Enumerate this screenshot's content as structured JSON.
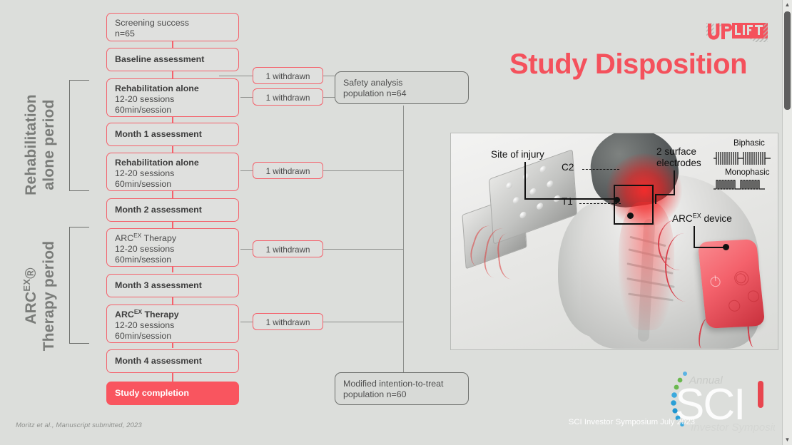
{
  "slide": {
    "title": "Study Disposition",
    "title_color": "#f4515c",
    "background_color": "#dcdedb",
    "citation": "Moritz et al., Manuscript submitted, 2023",
    "footer_note": "SCI Investor Symposium July 2023"
  },
  "logo_uplift": {
    "word_up": "UP",
    "word_lift": "LIFT",
    "color": "#f4515c"
  },
  "logo_sci": {
    "word_mark": "SCI",
    "top_word": "Annual",
    "bottom_word": "Investor Symposium",
    "accent_color": "#e8464f",
    "dot_colors": [
      "#5bb3e4",
      "#5bb3e4",
      "#6ab84f",
      "#6ab84f",
      "#3ba9dd",
      "#2b9fd6",
      "#2b9fd6",
      "#1f95d0",
      "#1f95d0",
      "#2b9fd6",
      "#3ba9dd"
    ]
  },
  "periods": [
    {
      "id": "rehab",
      "line1": "Rehabilitation",
      "line2": "alone period"
    },
    {
      "id": "arcex",
      "line1": "ARCEX®",
      "line1_base": "ARC",
      "line1_sup": "EX",
      "line1_tail": "®",
      "line2": "Therapy period"
    }
  ],
  "flow": {
    "nodes": [
      {
        "id": "screening",
        "bold": "",
        "lines": [
          "Screening success",
          "n=65"
        ],
        "style": "outline"
      },
      {
        "id": "baseline",
        "bold": "Baseline assessment",
        "lines": [],
        "style": "outline"
      },
      {
        "id": "rehab1",
        "bold": "Rehabilitation alone",
        "lines": [
          "12-20 sessions",
          "60min/session"
        ],
        "style": "outline"
      },
      {
        "id": "month1",
        "bold": "Month 1 assessment",
        "lines": [],
        "style": "outline"
      },
      {
        "id": "rehab2",
        "bold": "Rehabilitation alone",
        "lines": [
          "12-20 sessions",
          "60min/session"
        ],
        "style": "outline"
      },
      {
        "id": "month2",
        "bold": "Month 2 assessment",
        "lines": [],
        "style": "outline"
      },
      {
        "id": "arcex1",
        "bold": "",
        "lines": [
          "ARCEX Therapy",
          "12-20 sessions",
          "60min/session"
        ],
        "style": "outline",
        "has_sup": true
      },
      {
        "id": "month3",
        "bold": "Month 3 assessment",
        "lines": [],
        "style": "outline"
      },
      {
        "id": "arcex2",
        "bold": "ARCEX Therapy",
        "lines": [
          "12-20 sessions",
          "60min/session"
        ],
        "style": "outline",
        "has_sup": true
      },
      {
        "id": "month4",
        "bold": "Month 4 assessment",
        "lines": [],
        "style": "outline"
      },
      {
        "id": "completion",
        "bold": "Study completion",
        "lines": [],
        "style": "filled"
      }
    ],
    "withdrawals": [
      {
        "id": "w1",
        "label": "1 withdrawn"
      },
      {
        "id": "w2",
        "label": "1 withdrawn"
      },
      {
        "id": "w3",
        "label": "1 withdrawn"
      },
      {
        "id": "w4",
        "label": "1 withdrawn"
      },
      {
        "id": "w5",
        "label": "1 withdrawn"
      }
    ],
    "populations": [
      {
        "id": "safety",
        "line1": "Safety analysis",
        "line2": "population n=64"
      },
      {
        "id": "mitt",
        "line1": "Modified intention-to-treat",
        "line2": "population n=60"
      }
    ],
    "node_text": {
      "screening_l1": "Screening success",
      "screening_l2": "n=65",
      "baseline": "Baseline assessment",
      "rehab_title": "Rehabilitation alone",
      "sessions": "12-20 sessions",
      "duration": "60min/session",
      "month1": "Month 1 assessment",
      "month2": "Month 2 assessment",
      "month3": "Month 3 assessment",
      "month4": "Month 4 assessment",
      "arcex_base": "ARC",
      "arcex_sup": "EX",
      "arcex_tail": " Therapy",
      "completion": "Study completion",
      "withdrawn": "1 withdrawn",
      "safety_l1": "Safety analysis",
      "safety_l2": "population n=64",
      "mitt_l1": "Modified intention-to-treat",
      "mitt_l2": "population n=60"
    }
  },
  "figure": {
    "labels": {
      "site_of_injury": "Site of injury",
      "c2": "C2",
      "t1": "T1",
      "two_surface": "2 surface",
      "electrodes": "electrodes",
      "biphasic": "Biphasic",
      "monophasic": "Monophasic",
      "device_base": "ARC",
      "device_sup": "EX",
      "device_tail": " device"
    }
  },
  "scrollbar": {
    "up_arrow": "▲",
    "down_arrow": "▼"
  }
}
